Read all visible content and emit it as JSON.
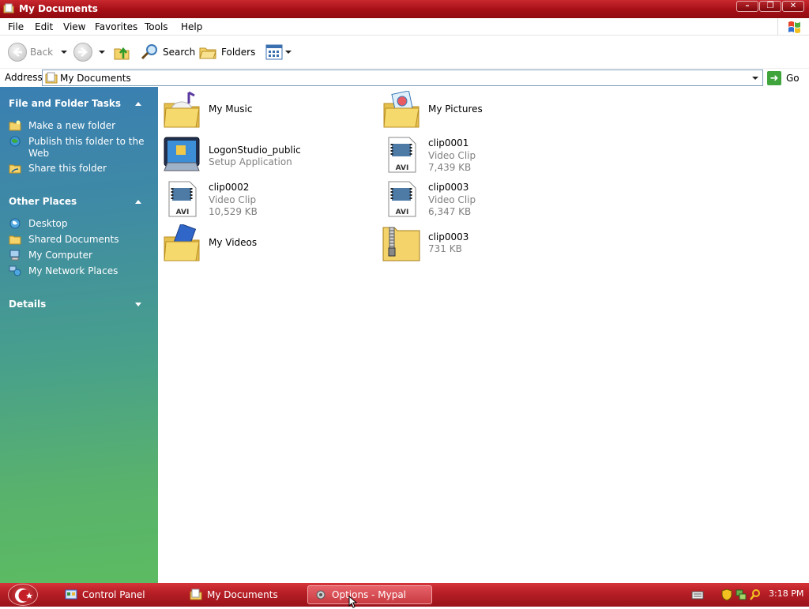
{
  "window": {
    "title": "My Documents",
    "controls": {
      "minimize": "–",
      "maximize": "❐",
      "close": "✕"
    }
  },
  "menu": [
    "File",
    "Edit",
    "View",
    "Favorites",
    "Tools",
    "Help"
  ],
  "toolbar": {
    "back_label": "Back",
    "search_label": "Search",
    "folders_label": "Folders"
  },
  "address": {
    "label": "Address",
    "value": "My Documents",
    "go_label": "Go"
  },
  "left_pane": {
    "tasks": {
      "title": "File and Folder Tasks",
      "items": [
        "Make a new folder",
        "Publish this folder to the Web",
        "Share this folder"
      ]
    },
    "other_places": {
      "title": "Other Places",
      "items": [
        "Desktop",
        "Shared Documents",
        "My Computer",
        "My Network Places"
      ]
    },
    "details": {
      "title": "Details"
    }
  },
  "files": [
    {
      "name": "My Music",
      "type": "",
      "size": "",
      "icon": "music-folder-icon"
    },
    {
      "name": "My Pictures",
      "type": "",
      "size": "",
      "icon": "pictures-folder-icon"
    },
    {
      "name": "LogonStudio_public",
      "type": "Setup Application",
      "size": "",
      "icon": "setup-application-icon"
    },
    {
      "name": "clip0001",
      "type": "Video Clip",
      "size": "7,439 KB",
      "icon": "avi-file-icon"
    },
    {
      "name": "clip0002",
      "type": "Video Clip",
      "size": "10,529 KB",
      "icon": "avi-file-icon"
    },
    {
      "name": "clip0003",
      "type": "Video Clip",
      "size": "6,347 KB",
      "icon": "avi-file-icon"
    },
    {
      "name": "My Videos",
      "type": "",
      "size": "",
      "icon": "videos-folder-icon"
    },
    {
      "name": "clip0003",
      "type": "731 KB",
      "size": "",
      "icon": "zip-folder-icon"
    }
  ],
  "taskbar": {
    "tasks": [
      "Control Panel",
      "My Documents",
      "Options - Mypal"
    ],
    "clock": "3:18 PM"
  },
  "colors": {
    "title_bar": "#a50f16",
    "taskbar": "#b81f26",
    "left_pane_top": "#3a7fb2",
    "left_pane_bottom": "#5cbb62",
    "folder_yellow": "#f3d36a"
  }
}
